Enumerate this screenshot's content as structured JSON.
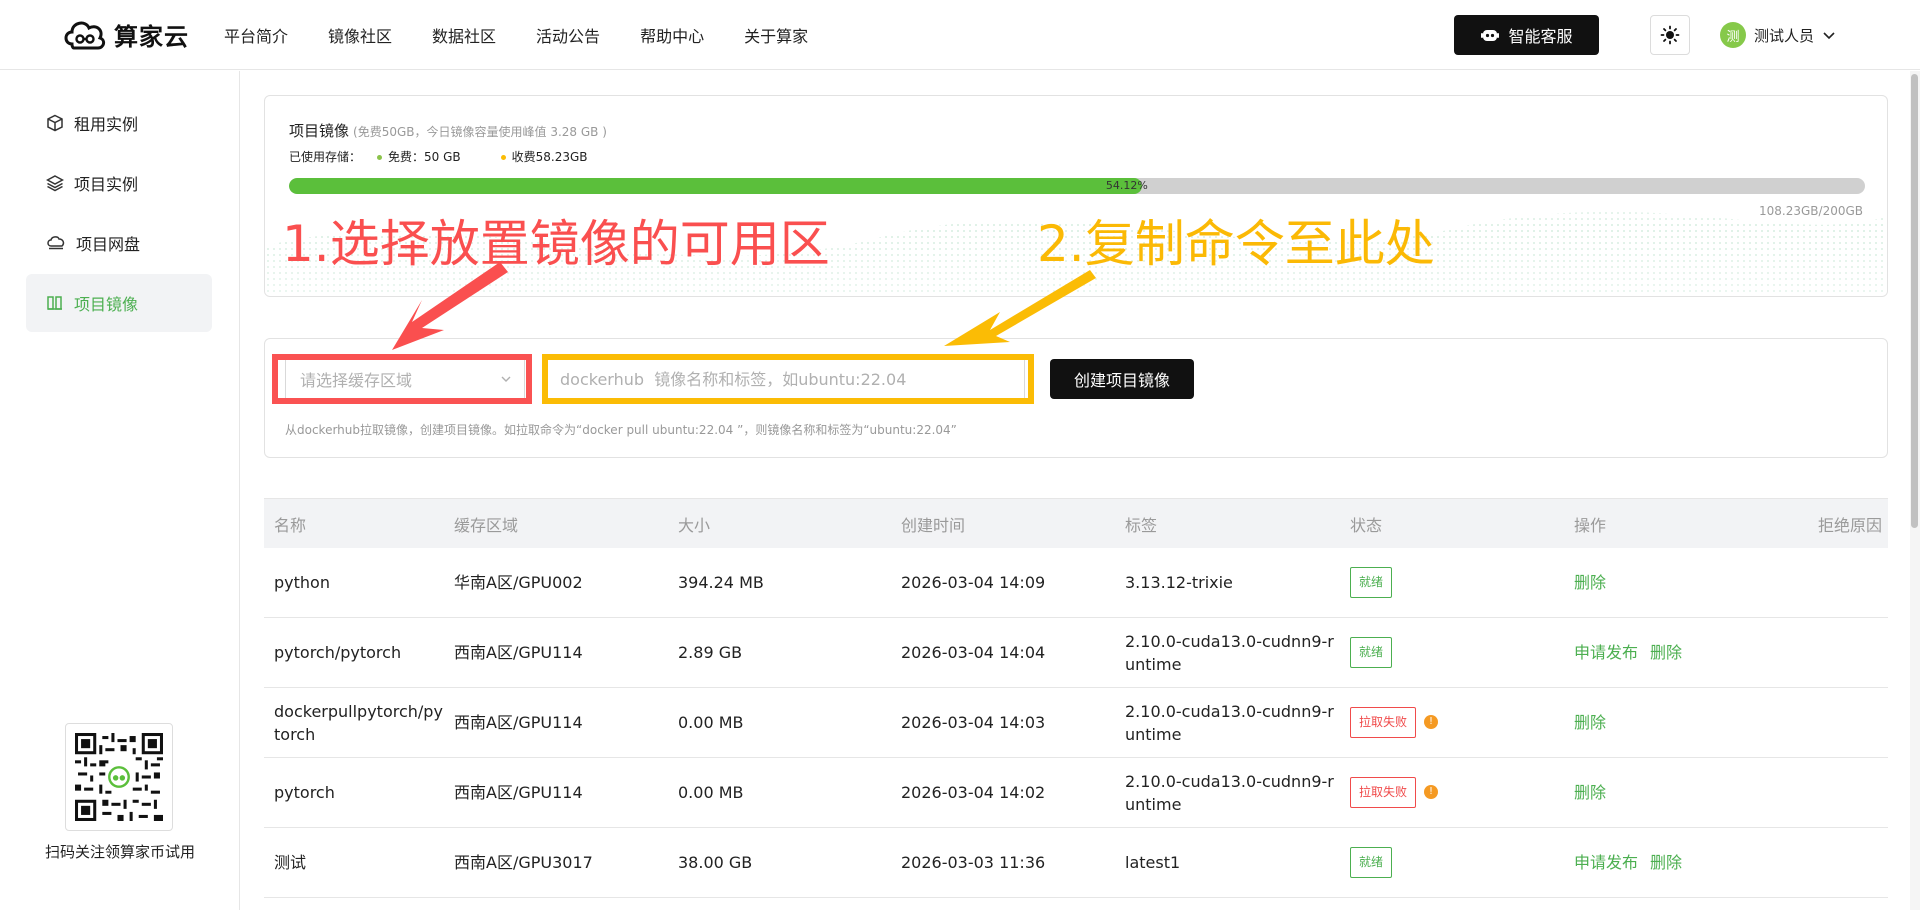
{
  "brand": {
    "name": "算家云"
  },
  "nav": {
    "items": [
      "平台简介",
      "镜像社区",
      "数据社区",
      "活动公告",
      "帮助中心",
      "关于算家"
    ]
  },
  "header": {
    "service_label": "智能客服",
    "user_avatar": "测",
    "user_name": "测试人员"
  },
  "sidebar": {
    "items": [
      {
        "label": "租用实例",
        "icon": "cube-icon"
      },
      {
        "label": "项目实例",
        "icon": "layers-icon"
      },
      {
        "label": "项目网盘",
        "icon": "cloud-drive-icon"
      },
      {
        "label": "项目镜像",
        "icon": "image-icon",
        "active": true
      }
    ],
    "qr_caption": "扫码关注领算家币试用"
  },
  "storage": {
    "title": "项目镜像",
    "subtitle": "(免费50GB，今日镜像容量使用峰值 3.28 GB )",
    "used_label": "已使用存储：",
    "free_label": "免费：50 GB",
    "paid_label": "收费58.23GB",
    "percent": 54.12,
    "percent_label": "54.12%",
    "total_label": "108.23GB/200GB",
    "colors": {
      "free": "#8bc34a",
      "paid": "#fbbc05",
      "fill": "#5bbf3b"
    }
  },
  "create": {
    "region_placeholder": "请选择缓存区域",
    "name_placeholder": "dockerhub  镜像名称和标签，如ubuntu:22.04",
    "button_label": "创建项目镜像",
    "hint": "从dockerhub拉取镜像，创建项目镜像。如拉取命令为“docker pull ubuntu:22.04 ”，则镜像名称和标签为“ubuntu:22.04”"
  },
  "annotations": {
    "step1": "1.选择放置镜像的可用区",
    "step2": "2.复制命令至此处",
    "colors": {
      "step1": "#fa4f4f",
      "step2": "#fbb905"
    }
  },
  "table": {
    "headers": [
      "名称",
      "缓存区域",
      "大小",
      "创建时间",
      "标签",
      "状态",
      "操作",
      "拒绝原因"
    ],
    "rows": [
      {
        "name": "python",
        "region": "华南A区/GPU002",
        "size": "394.24 MB",
        "created": "2026-03-04 14:09",
        "tag": "3.13.12-trixie",
        "status": "就绪",
        "status_type": "ok",
        "ops": [
          "删除"
        ]
      },
      {
        "name": "pytorch/pytorch",
        "region": "西南A区/GPU114",
        "size": "2.89 GB",
        "created": "2026-03-04 14:04",
        "tag": "2.10.0-cuda13.0-cudnn9-runtime",
        "status": "就绪",
        "status_type": "ok",
        "ops": [
          "申请发布",
          "删除"
        ]
      },
      {
        "name": "dockerpullpytorch/pytorch",
        "region": "西南A区/GPU114",
        "size": "0.00 MB",
        "created": "2026-03-04 14:03",
        "tag": "2.10.0-cuda13.0-cudnn9-runtime",
        "status": "拉取失败",
        "status_type": "fail",
        "ops": [
          "删除"
        ]
      },
      {
        "name": "pytorch",
        "region": "西南A区/GPU114",
        "size": "0.00 MB",
        "created": "2026-03-04 14:02",
        "tag": "2.10.0-cuda13.0-cudnn9-runtime",
        "status": "拉取失败",
        "status_type": "fail",
        "ops": [
          "删除"
        ]
      },
      {
        "name": "测试",
        "region": "西南A区/GPU3017",
        "size": "38.00 GB",
        "created": "2026-03-03 11:36",
        "tag": "latest1",
        "status": "就绪",
        "status_type": "ok",
        "ops": [
          "申请发布",
          "删除"
        ]
      }
    ]
  }
}
